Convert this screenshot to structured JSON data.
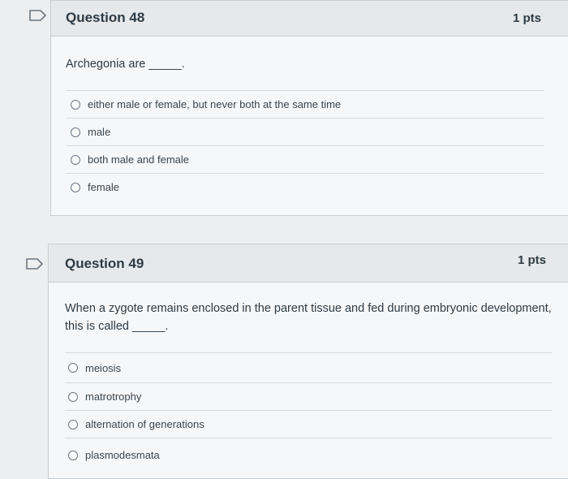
{
  "questions": [
    {
      "title": "Question 48",
      "points": "1 pts",
      "text": "Archegonia are",
      "blank": "_____.",
      "answers": [
        "either male or female, but never both at the same time",
        "male",
        "both male and female",
        "female"
      ]
    },
    {
      "title": "Question 49",
      "points": "1 pts",
      "text": "When a zygote remains enclosed in the parent tissue and fed during embryonic development, this is called",
      "blank": "_____.",
      "answers": [
        "meiosis",
        "matrotrophy",
        "alternation of generations",
        "plasmodesmata"
      ]
    }
  ],
  "colors": {
    "page_bg": "#eceeef",
    "card_bg": "#f6f7f8",
    "header_bg": "#e6e9eb",
    "border": "#c7cdd1",
    "text": "#2d3b45"
  },
  "icons": [
    "flag-icon",
    "radio-icon"
  ]
}
